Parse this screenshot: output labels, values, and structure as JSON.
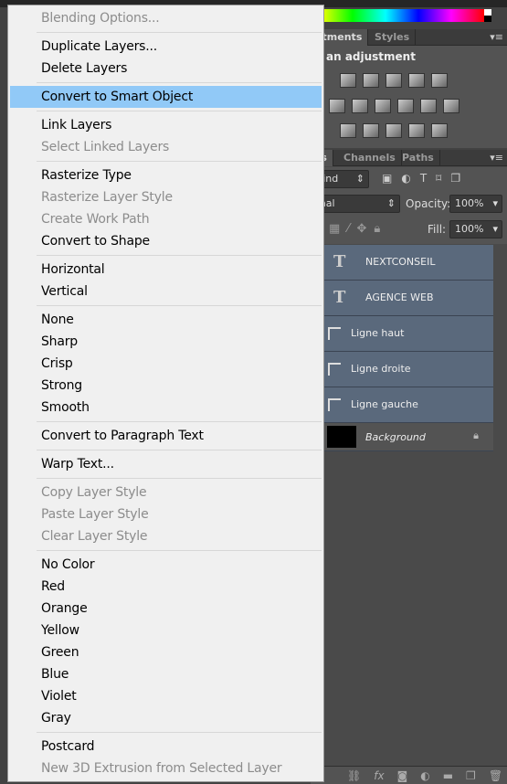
{
  "menu": {
    "groups": [
      [
        {
          "label": "Blending Options...",
          "enabled": false
        }
      ],
      [
        {
          "label": "Duplicate Layers...",
          "enabled": true
        },
        {
          "label": "Delete Layers",
          "enabled": true
        }
      ],
      [
        {
          "label": "Convert to Smart Object",
          "enabled": true,
          "highlighted": true
        }
      ],
      [
        {
          "label": "Link Layers",
          "enabled": true
        },
        {
          "label": "Select Linked Layers",
          "enabled": false
        }
      ],
      [
        {
          "label": "Rasterize Type",
          "enabled": true
        },
        {
          "label": "Rasterize Layer Style",
          "enabled": false
        },
        {
          "label": "Create Work Path",
          "enabled": false
        },
        {
          "label": "Convert to Shape",
          "enabled": true
        }
      ],
      [
        {
          "label": "Horizontal",
          "enabled": true
        },
        {
          "label": "Vertical",
          "enabled": true
        }
      ],
      [
        {
          "label": "None",
          "enabled": true
        },
        {
          "label": "Sharp",
          "enabled": true
        },
        {
          "label": "Crisp",
          "enabled": true
        },
        {
          "label": "Strong",
          "enabled": true
        },
        {
          "label": "Smooth",
          "enabled": true
        }
      ],
      [
        {
          "label": "Convert to Paragraph Text",
          "enabled": true
        }
      ],
      [
        {
          "label": "Warp Text...",
          "enabled": true
        }
      ],
      [
        {
          "label": "Copy Layer Style",
          "enabled": false
        },
        {
          "label": "Paste Layer Style",
          "enabled": false
        },
        {
          "label": "Clear Layer Style",
          "enabled": false
        }
      ],
      [
        {
          "label": "No Color",
          "enabled": true
        },
        {
          "label": "Red",
          "enabled": true
        },
        {
          "label": "Orange",
          "enabled": true
        },
        {
          "label": "Yellow",
          "enabled": true
        },
        {
          "label": "Green",
          "enabled": true
        },
        {
          "label": "Blue",
          "enabled": true
        },
        {
          "label": "Violet",
          "enabled": true
        },
        {
          "label": "Gray",
          "enabled": true
        }
      ],
      [
        {
          "label": "Postcard",
          "enabled": true
        },
        {
          "label": "New 3D Extrusion from Selected Layer",
          "enabled": false
        }
      ]
    ]
  },
  "adjustments": {
    "tabs": [
      "stments",
      "Styles"
    ],
    "title": "an adjustment"
  },
  "layers": {
    "tabs": [
      "rs",
      "Channels",
      "Paths"
    ],
    "filter": "Kind",
    "blend_mode": "mal",
    "opacity_label": "Opacity:",
    "opacity": "100%",
    "fill_label": "Fill:",
    "fill": "100%",
    "items": [
      {
        "name": "NEXTCONSEIL",
        "type": "text"
      },
      {
        "name": "AGENCE WEB",
        "type": "text"
      },
      {
        "name": "Ligne haut",
        "type": "shape"
      },
      {
        "name": "Ligne droite",
        "type": "shape"
      },
      {
        "name": "Ligne gauche",
        "type": "shape"
      },
      {
        "name": "Background",
        "type": "background",
        "locked": true
      }
    ]
  },
  "colors": {
    "highlight": "#91c9f7",
    "menu_bg": "#f0f0f0",
    "layer_selected": "#5a697c",
    "panel": "#535353"
  }
}
